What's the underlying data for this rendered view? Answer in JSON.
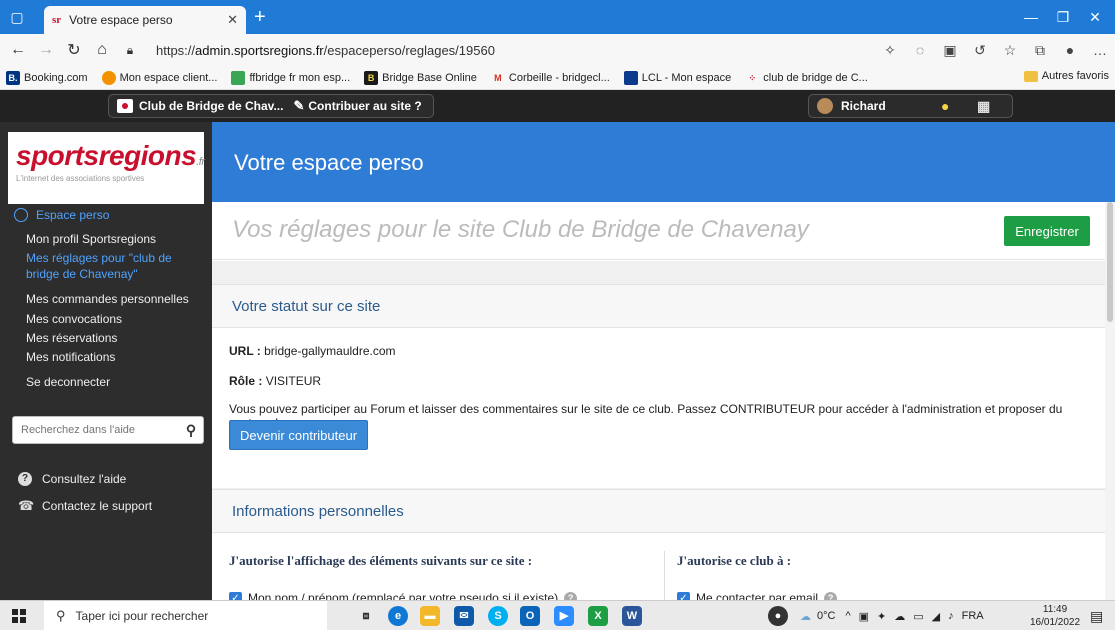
{
  "browser": {
    "tab_title": "Votre espace perso",
    "tab_favicon": "sr",
    "url_prefix": "https://",
    "url_host": "admin.sportsregions.fr",
    "url_path": "/espaceperso/reglages/19560",
    "bookmarks": [
      {
        "label": "Booking.com",
        "icon_text": "B.",
        "color": "#003580"
      },
      {
        "label": "Mon espace client...",
        "icon_text": "",
        "color": "#f39200"
      },
      {
        "label": "ffbridge fr mon esp...",
        "icon_text": "",
        "color": "#3aa655"
      },
      {
        "label": "Bridge Base Online",
        "icon_text": "B",
        "color": "#1a1a1a"
      },
      {
        "label": "Corbeille - bridgecl...",
        "icon_text": "M",
        "color": "#d93025"
      },
      {
        "label": "LCL - Mon espace",
        "icon_text": "",
        "color": "#0b3a8a"
      },
      {
        "label": "club de bridge de C...",
        "icon_text": "",
        "color": "#c8102e"
      }
    ],
    "other_bookmarks": "Autres favoris"
  },
  "sitebar": {
    "club_name": "Club de Bridge de Chav...",
    "contribute": "Contribuer au site ?",
    "user_name": "Richard"
  },
  "sidebar": {
    "logo_text": "sportsregions",
    "logo_suffix": ".fr",
    "logo_tagline": "L'internet des associations sportives",
    "section_title": "Espace perso",
    "items": [
      "Mon profil Sportsregions",
      "Mes réglages pour \"club de bridge de Chavenay\"",
      "Mes commandes personnelles",
      "Mes convocations",
      "Mes réservations",
      "Mes notifications",
      "Se deconnecter"
    ],
    "search_placeholder": "Recherchez dans l'aide",
    "help_link": "Consultez l'aide",
    "support_link": "Contactez le support"
  },
  "main": {
    "page_title": "Votre espace perso",
    "settings_title": "Vos réglages pour le site Club de Bridge de Chavenay",
    "save_label": "Enregistrer",
    "status_section": "Votre statut sur ce site",
    "url_label": "URL :",
    "url_value": "bridge-gallymauldre.com",
    "role_label": "Rôle :",
    "role_value": "VISITEUR",
    "status_message": "Vous pouvez participer au Forum et laisser des commentaires sur le site de ce club. Passez CONTRIBUTEUR pour accéder à l'administration et proposer du contenu !",
    "contrib_button": "Devenir contributeur",
    "info_section": "Informations personnelles",
    "left_col_title": "J'autorise l'affichage des éléments suivants sur ce site :",
    "right_col_title": "J'autorise ce club à :",
    "left_check": "Mon nom / prénom (remplacé par votre pseudo si il existe)",
    "right_check": "Me contacter par email"
  },
  "taskbar": {
    "search_placeholder": "Taper ici pour rechercher",
    "temperature": "0°C",
    "language": "FRA",
    "time": "11:49",
    "date": "16/01/2022"
  },
  "colors": {
    "accent_blue": "#2e7cd6",
    "save_green": "#1e9e44",
    "sidebar_dark": "#2d2d2d",
    "brand_red": "#c8102e"
  }
}
